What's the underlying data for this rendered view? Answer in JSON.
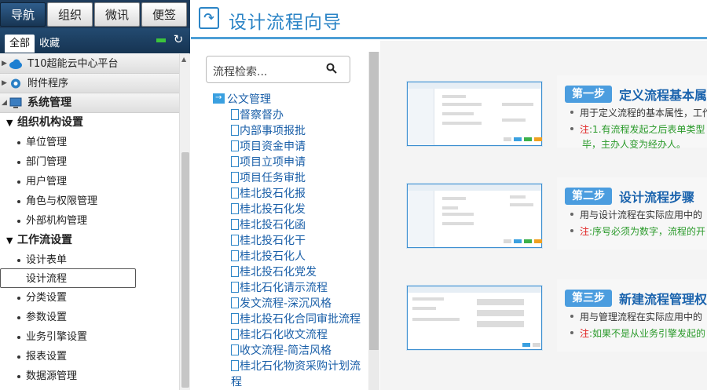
{
  "nav": {
    "top_tabs": [
      "导航",
      "组织",
      "微讯",
      "便签"
    ],
    "sub_tabs": [
      "全部",
      "收藏"
    ],
    "tree": [
      {
        "kind": "top",
        "label": "T10超能云中心平台",
        "icon": "cloud-icon"
      },
      {
        "kind": "top",
        "label": "附件程序",
        "icon": "gear-icon"
      },
      {
        "kind": "top-bold",
        "label": "系统管理",
        "icon": "computer-icon"
      },
      {
        "kind": "group",
        "label": "组织机构设置"
      },
      {
        "kind": "leaf",
        "label": "单位管理"
      },
      {
        "kind": "leaf",
        "label": "部门管理"
      },
      {
        "kind": "leaf",
        "label": "用户管理"
      },
      {
        "kind": "leaf",
        "label": "角色与权限管理"
      },
      {
        "kind": "leaf",
        "label": "外部机构管理"
      },
      {
        "kind": "group",
        "label": "工作流设置"
      },
      {
        "kind": "leaf",
        "label": "设计表单"
      },
      {
        "kind": "selected",
        "label": "设计流程"
      },
      {
        "kind": "leaf",
        "label": "分类设置"
      },
      {
        "kind": "leaf",
        "label": "参数设置"
      },
      {
        "kind": "leaf",
        "label": "业务引擎设置"
      },
      {
        "kind": "leaf",
        "label": "报表设置"
      },
      {
        "kind": "leaf",
        "label": "数据源管理"
      }
    ]
  },
  "page": {
    "title": "设计流程向导"
  },
  "search": {
    "placeholder": "流程检索..."
  },
  "flow_tree": {
    "folder": "公文管理",
    "items": [
      "督察督办",
      "内部事项报批",
      "项目资金申请",
      "项目立项申请",
      "项目任务审批",
      "桂北投石化报",
      "桂北投石化发",
      "桂北投石化函",
      "桂北投石化干",
      "桂北投石化人",
      "桂北投石化党发",
      "桂北石化请示流程",
      "发文流程-深沉风格",
      "桂北投石化合同审批流程",
      "桂北石化收文流程",
      "收文流程-简洁风格",
      "桂北石化物资采购计划流程"
    ]
  },
  "steps": [
    {
      "badge": "第一步",
      "title": "定义流程基本属",
      "line1": "用于定义流程的基本属性，工作",
      "note_label": "注",
      "note": ":1.有流程发起之后表单类型",
      "note_cont": "毕，主办人变为经办人。"
    },
    {
      "badge": "第二步",
      "title": "设计流程步骤",
      "line1": "用与设计流程在实际应用中的",
      "note_label": "注",
      "note": ":序号必须为数字，流程的开",
      "note_cont": ""
    },
    {
      "badge": "第三步",
      "title": "新建流程管理权",
      "line1": "用与管理流程在实际应用中的",
      "note_label": "注",
      "note": ":如果不是从业务引擎发起的",
      "note_cont": ""
    }
  ],
  "colors": {
    "accent": "#2b84c6",
    "nav_dark": "#1e3b5a",
    "note_green": "#2a9a2a",
    "note_red": "#e02020"
  }
}
